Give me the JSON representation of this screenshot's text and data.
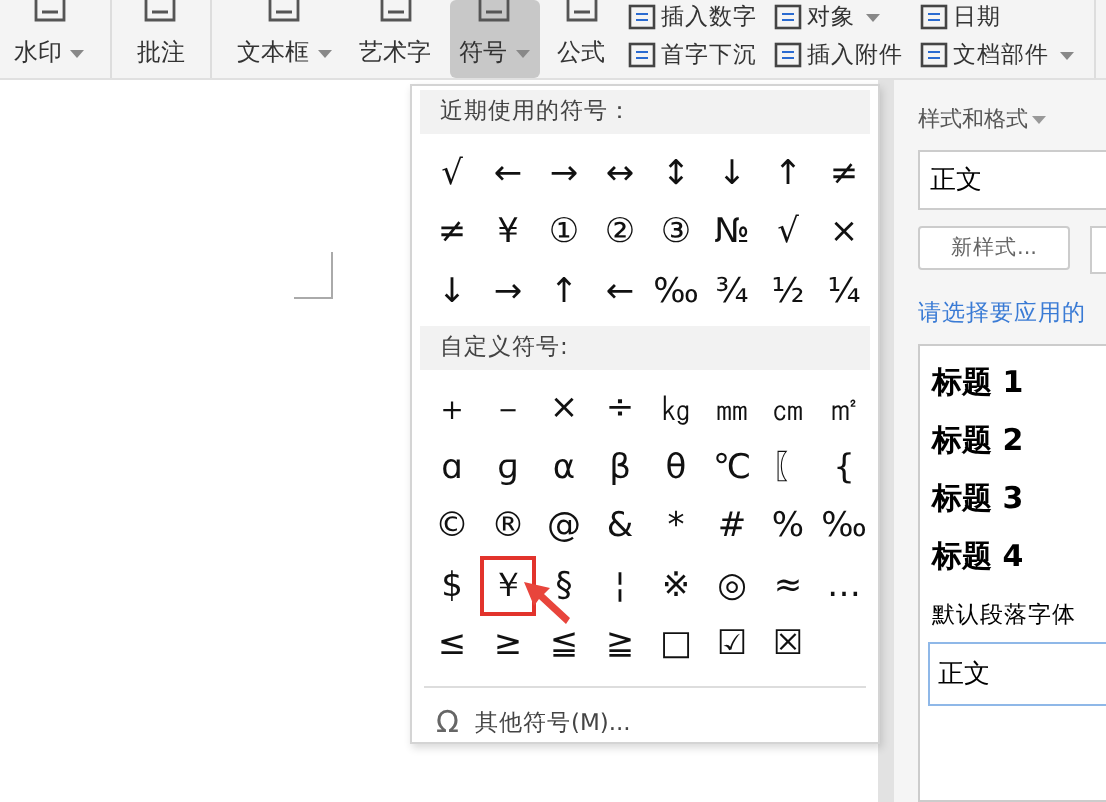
{
  "ribbon": {
    "big_buttons": [
      {
        "label": "水印",
        "dropdown": true,
        "selected": false
      },
      {
        "label": "批注",
        "dropdown": false,
        "selected": false
      },
      {
        "label": "文本框",
        "dropdown": true,
        "selected": false
      },
      {
        "label": "艺术字",
        "dropdown": false,
        "selected": false
      },
      {
        "label": "符号",
        "dropdown": true,
        "selected": true
      },
      {
        "label": "公式",
        "dropdown": false,
        "selected": false
      }
    ],
    "small_columns": [
      [
        {
          "label": "插入数字",
          "dropdown": false
        },
        {
          "label": "首字下沉",
          "dropdown": false
        }
      ],
      [
        {
          "label": "对象",
          "dropdown": true
        },
        {
          "label": "插入附件",
          "dropdown": false
        }
      ],
      [
        {
          "label": "日期",
          "dropdown": false
        },
        {
          "label": "文档部件",
          "dropdown": true
        }
      ]
    ]
  },
  "symbol_menu": {
    "recent_title": "近期使用的符号：",
    "recent": [
      "√",
      "←",
      "→",
      "↔",
      "↕",
      "↓",
      "↑",
      "≠",
      "≠",
      "¥",
      "①",
      "②",
      "③",
      "№",
      "√",
      "×",
      "↓",
      "→",
      "↑",
      "←",
      "‰",
      "¾",
      "½",
      "¼"
    ],
    "custom_title": "自定义符号:",
    "custom": [
      {
        "symbol": "＋",
        "selected": false
      },
      {
        "symbol": "－",
        "selected": false
      },
      {
        "symbol": "×",
        "selected": false
      },
      {
        "symbol": "÷",
        "selected": false
      },
      {
        "symbol": "㎏",
        "selected": false
      },
      {
        "symbol": "㎜",
        "selected": false
      },
      {
        "symbol": "㎝",
        "selected": false
      },
      {
        "symbol": "㎡",
        "selected": false
      },
      {
        "symbol": "ɑ",
        "selected": false
      },
      {
        "symbol": "ɡ",
        "selected": false
      },
      {
        "symbol": "α",
        "selected": false
      },
      {
        "symbol": "β",
        "selected": false
      },
      {
        "symbol": "θ",
        "selected": false
      },
      {
        "symbol": "℃",
        "selected": false
      },
      {
        "symbol": "〖",
        "selected": false
      },
      {
        "symbol": "{",
        "selected": false
      },
      {
        "symbol": "©",
        "selected": false
      },
      {
        "symbol": "®",
        "selected": false
      },
      {
        "symbol": "@",
        "selected": false
      },
      {
        "symbol": "&",
        "selected": false
      },
      {
        "symbol": "*",
        "selected": false
      },
      {
        "symbol": "#",
        "selected": false
      },
      {
        "symbol": "%",
        "selected": false
      },
      {
        "symbol": "‰",
        "selected": false
      },
      {
        "symbol": "$",
        "selected": false
      },
      {
        "symbol": "￥",
        "selected": true
      },
      {
        "symbol": "§",
        "selected": false
      },
      {
        "symbol": "¦",
        "selected": false
      },
      {
        "symbol": "※",
        "selected": false
      },
      {
        "symbol": "◎",
        "selected": false
      },
      {
        "symbol": "≈",
        "selected": false
      },
      {
        "symbol": "…",
        "selected": false
      },
      {
        "symbol": "≤",
        "selected": false
      },
      {
        "symbol": "≥",
        "selected": false
      },
      {
        "symbol": "≦",
        "selected": false
      },
      {
        "symbol": "≧",
        "selected": false
      },
      {
        "symbol": "□",
        "selected": false
      },
      {
        "symbol": "☑",
        "selected": false
      },
      {
        "symbol": "☒",
        "selected": false
      }
    ],
    "more_icon": "Ω",
    "more_label": "其他符号(M)..."
  },
  "styles_panel": {
    "title": "样式和格式",
    "style_field": "正文",
    "new_style_button": "新样式...",
    "hint": "请选择要应用的",
    "styles": [
      {
        "label": "标题 1",
        "kind": "heading"
      },
      {
        "label": "标题 2",
        "kind": "heading"
      },
      {
        "label": "标题 3",
        "kind": "heading"
      },
      {
        "label": "标题 4",
        "kind": "heading"
      },
      {
        "label": "默认段落字体",
        "kind": "plain"
      },
      {
        "label": "正文",
        "kind": "boxed"
      }
    ]
  }
}
